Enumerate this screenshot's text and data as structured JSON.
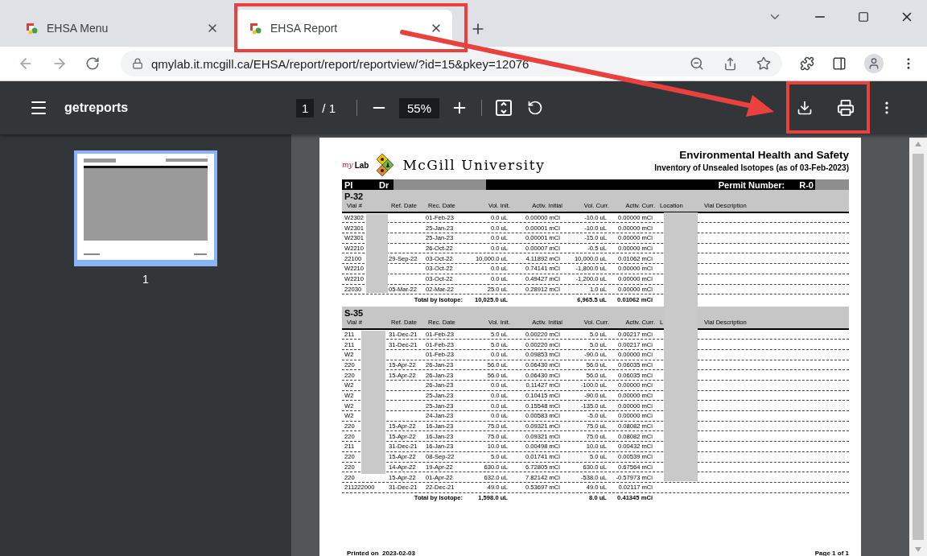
{
  "browser": {
    "tabs": [
      {
        "title": "EHSA Menu",
        "selected": false
      },
      {
        "title": "EHSA Report",
        "selected": true
      }
    ],
    "url": "qmylab.it.mcgill.ca/EHSA/report/report/reportview/?id=15&pkey=12076"
  },
  "pdf_viewer": {
    "title": "getreports",
    "page": "1",
    "page_count": "/ 1",
    "zoom": "55%",
    "thumbnail_label": "1"
  },
  "report": {
    "logo_my": "my",
    "logo_lab": "Lab",
    "university": "McGill University",
    "title": "Environmental Health and Safety",
    "subtitle": "Inventory of Unsealed Isotopes (as of 03-Feb-2023)",
    "pi_label": "PI",
    "pi_name": "Dr",
    "permit_label": "Permit Number:",
    "permit_value": "R-0",
    "sections": [
      {
        "isotope": "P-32",
        "columns": [
          "Vial #",
          "Ref. Date",
          "Rec. Date",
          "Vol. Init.",
          "Activ. Initial",
          "Vol. Curr.",
          "Activ. Curr.",
          "Location",
          "Vial Description"
        ],
        "rows": [
          {
            "vial": "W2302",
            "rec_date": "01-Feb-23",
            "vol_init": "0.0 uL",
            "activ_init": "0.00000 mCi",
            "vol_curr": "-10.0 uL",
            "activ_curr": "0.00000 mCi"
          },
          {
            "vial": "W2301",
            "rec_date": "25-Jan-23",
            "vol_init": "0.0 uL",
            "activ_init": "0.00001 mCi",
            "vol_curr": "-10.0 uL",
            "activ_curr": "0.00000 mCi"
          },
          {
            "vial": "W2301",
            "rec_date": "25-Jan-23",
            "vol_init": "0.0 uL",
            "activ_init": "0.00001 mCi",
            "vol_curr": "-15.0 uL",
            "activ_curr": "0.00000 mCi"
          },
          {
            "vial": "W2210",
            "rec_date": "26-Oct-22",
            "vol_init": "0.0 uL",
            "activ_init": "0.00007 mCi",
            "vol_curr": "-0.5 uL",
            "activ_curr": "0.00000 mCi"
          },
          {
            "vial": "22100",
            "ref_date": "29-Sep-22",
            "rec_date": "03-Oct-22",
            "vol_init": "10,000.0 uL",
            "activ_init": "4.11892 mCi",
            "vol_curr": "10,000.0 uL",
            "activ_curr": "0.01062 mCi"
          },
          {
            "vial": "W2210",
            "rec_date": "03-Oct-22",
            "vol_init": "0.0 uL",
            "activ_init": "0.74141 mCi",
            "vol_curr": "-1,800.0 uL",
            "activ_curr": "0.00000 mCi"
          },
          {
            "vial": "W2210",
            "rec_date": "03-Oct-22",
            "vol_init": "0.0 uL",
            "activ_init": "0.49427 mCi",
            "vol_curr": "-1,200.0 uL",
            "activ_curr": "0.00000 mCi"
          },
          {
            "vial": "22030",
            "ref_date": "05-Mar-22",
            "rec_date": "02-Mar-22",
            "vol_init": "25.0 uL",
            "activ_init": "0.28912 mCi",
            "vol_curr": "1.0 uL",
            "activ_curr": "0.00000 mCi"
          }
        ],
        "total": {
          "label": "Total by Isotope:",
          "vol_init": "10,025.0 uL",
          "vol_curr": "6,965.5 uL",
          "activ_curr": "0.01062 mCi"
        }
      },
      {
        "isotope": "S-35",
        "columns": [
          "Vial #",
          "Ref. Date",
          "Rec. Date",
          "Vol. Init.",
          "Activ. Initial",
          "Vol. Curr.",
          "Activ. Curr.",
          "L",
          "Vial Description"
        ],
        "rows": [
          {
            "vial": "211",
            "ref_date": "31-Dec-21",
            "rec_date": "01-Feb-23",
            "vol_init": "5.0 uL",
            "activ_init": "0.00220 mCi",
            "vol_curr": "5.0 uL",
            "activ_curr": "0.00217 mCi"
          },
          {
            "vial": "211",
            "ref_date": "31-Dec-21",
            "rec_date": "01-Feb-23",
            "vol_init": "5.0 uL",
            "activ_init": "0.00220 mCi",
            "vol_curr": "5.0 uL",
            "activ_curr": "0.00217 mCi"
          },
          {
            "vial": "W2",
            "rec_date": "01-Feb-23",
            "vol_init": "0.0 uL",
            "activ_init": "0.09853 mCi",
            "vol_curr": "-90.0 uL",
            "activ_curr": "0.00000 mCi"
          },
          {
            "vial": "220",
            "ref_date": "15-Apr-22",
            "rec_date": "26-Jan-23",
            "vol_init": "56.0 uL",
            "activ_init": "0.06430 mCi",
            "vol_curr": "56.0 uL",
            "activ_curr": "0.06035 mCi"
          },
          {
            "vial": "220",
            "ref_date": "15-Apr-22",
            "rec_date": "26-Jan-23",
            "vol_init": "56.0 uL",
            "activ_init": "0.06430 mCi",
            "vol_curr": "56.0 uL",
            "activ_curr": "0.06035 mCi"
          },
          {
            "vial": "W2",
            "rec_date": "26-Jan-23",
            "vol_init": "0.0 uL",
            "activ_init": "0.11427 mCi",
            "vol_curr": "-100.0 uL",
            "activ_curr": "0.00000 mCi"
          },
          {
            "vial": "W2",
            "rec_date": "25-Jan-23",
            "vol_init": "0.0 uL",
            "activ_init": "0.10415 mCi",
            "vol_curr": "-90.0 uL",
            "activ_curr": "0.00000 mCi"
          },
          {
            "vial": "W2",
            "rec_date": "25-Jan-23",
            "vol_init": "0.0 uL",
            "activ_init": "0.15548 mCi",
            "vol_curr": "-135.0 uL",
            "activ_curr": "0.00000 mCi"
          },
          {
            "vial": "W2",
            "rec_date": "24-Jan-23",
            "vol_init": "0.0 uL",
            "activ_init": "0.00583 mCi",
            "vol_curr": "-5.0 uL",
            "activ_curr": "0.00000 mCi"
          },
          {
            "vial": "220",
            "ref_date": "15-Apr-22",
            "rec_date": "16-Jan-23",
            "vol_init": "75.0 uL",
            "activ_init": "0.09321 mCi",
            "vol_curr": "75.0 uL",
            "activ_curr": "0.08082 mCi"
          },
          {
            "vial": "220",
            "ref_date": "15-Apr-22",
            "rec_date": "16-Jan-23",
            "vol_init": "75.0 uL",
            "activ_init": "0.09321 mCi",
            "vol_curr": "75.0 uL",
            "activ_curr": "0.08082 mCi"
          },
          {
            "vial": "211",
            "ref_date": "31-Dec-21",
            "rec_date": "16-Jan-23",
            "vol_init": "10.0 uL",
            "activ_init": "0.00498 mCi",
            "vol_curr": "10.0 uL",
            "activ_curr": "0.00432 mCi"
          },
          {
            "vial": "220",
            "ref_date": "15-Apr-22",
            "rec_date": "08-Sep-22",
            "vol_init": "5.0 uL",
            "activ_init": "0.01741 mCi",
            "vol_curr": "5.0 uL",
            "activ_curr": "0.00539 mCi"
          },
          {
            "vial": "220",
            "ref_date": "14-Apr-22",
            "rec_date": "19-Apr-22",
            "vol_init": "630.0 uL",
            "activ_init": "6.72805 mCi",
            "vol_curr": "630.0 uL",
            "activ_curr": "0.67564 mCi"
          },
          {
            "vial": "220",
            "ref_date": "15-Apr-22",
            "rec_date": "01-Apr-22",
            "vol_init": "632.0 uL",
            "activ_init": "7.82142 mCi",
            "vol_curr": "-538.0 uL",
            "activ_curr": "-0.57973 mCi"
          },
          {
            "vial": "211222000",
            "ref_date": "31-Dec-21",
            "rec_date": "22-Dec-21",
            "vol_init": "49.0 uL",
            "activ_init": "0.53697 mCi",
            "vol_curr": "49.0 uL",
            "activ_curr": "0.02117 mCi"
          }
        ],
        "total": {
          "label": "Total by Isotope:",
          "vol_init": "1,598.0 uL",
          "vol_curr": "8.0 uL",
          "activ_curr": "0.41345 mCi"
        }
      }
    ],
    "printed_label": "Printed on",
    "printed_date": "2023-02-03",
    "page_label": "Page 1 of 1"
  }
}
